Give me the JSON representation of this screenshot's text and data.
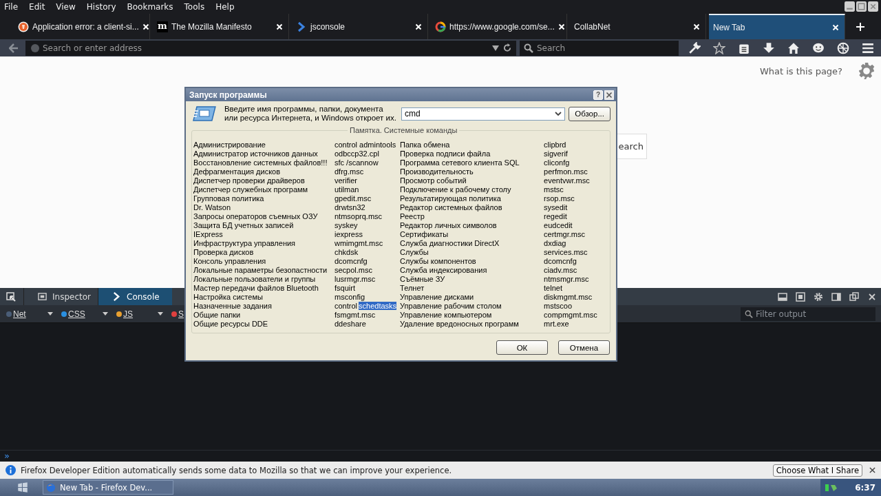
{
  "menu": [
    "File",
    "Edit",
    "View",
    "History",
    "Bookmarks",
    "Tools",
    "Help"
  ],
  "tabs": [
    {
      "title": "Application error: a client-si...",
      "selected": false
    },
    {
      "title": "The Mozilla Manifesto",
      "selected": false,
      "icon_text": "m"
    },
    {
      "title": "jsconsole",
      "selected": false
    },
    {
      "title": "https://www.google.com/se...",
      "selected": false
    },
    {
      "title": "CollabNet",
      "selected": false
    },
    {
      "title": "New Tab",
      "selected": true
    }
  ],
  "address": {
    "placeholder": "Search or enter address"
  },
  "search": {
    "placeholder": "Search"
  },
  "page": {
    "help_link": "What is this page?",
    "search_button": "earch"
  },
  "devtools": {
    "tabs": [
      {
        "label": "Inspector",
        "selected": false
      },
      {
        "label": "Console",
        "selected": true
      }
    ],
    "filters": [
      {
        "label": "Net",
        "color": "#4a5d77"
      },
      {
        "label": "CSS",
        "color": "#2a8fe0"
      },
      {
        "label": "JS",
        "color": "#e8a030"
      },
      {
        "label": "S",
        "color": "#e0403f"
      }
    ],
    "filter_placeholder": "Filter output",
    "prompt": "»"
  },
  "notification": {
    "text": "Firefox Developer Edition automatically sends some data to Mozilla so that we can improve your experience.",
    "button": "Choose What I Share"
  },
  "taskbar": {
    "task": "New Tab - Firefox Dev...",
    "clock": "6:37"
  },
  "dialog": {
    "title": "Запуск программы",
    "help": "?",
    "intro": "Введите имя программы, папки, документа или ресурса Интернета, и Windows откроет их.",
    "value": "cmd",
    "browse": "Обзор...",
    "group_title": "Памятка. Системные команды",
    "left": [
      {
        "name": "Администрирование",
        "command": "control admintools"
      },
      {
        "name": "Администратор источников данных",
        "command": "odbccp32.cpl"
      },
      {
        "name": "Восстановление системных файлов!!!",
        "command": "sfc /scannow"
      },
      {
        "name": "Дефрагментация дисков",
        "command": "dfrg.msc"
      },
      {
        "name": "Диспетчер проверки драйверов",
        "command": "verifier"
      },
      {
        "name": "Диспетчер служебных программ",
        "command": "utilman"
      },
      {
        "name": "Групповая политика",
        "command": "gpedit.msc"
      },
      {
        "name": "Dr. Watson",
        "command": "drwtsn32"
      },
      {
        "name": "Запросы операторов съемных ОЗУ",
        "command": "ntmsoprq.msc"
      },
      {
        "name": "Защита БД учетных записей",
        "command": "syskey"
      },
      {
        "name": "IExpress",
        "command": "iexpress"
      },
      {
        "name": "Инфраструктура управления",
        "command": "wmimgmt.msc"
      },
      {
        "name": "Проверка дисков",
        "command": "chkdsk"
      },
      {
        "name": "Консоль управления",
        "command": "dcomcnfg"
      },
      {
        "name": "Локальные параметры безопастности",
        "command": "secpol.msc"
      },
      {
        "name": "Локальные пользователи и группы",
        "command": "lusrmgr.msc"
      },
      {
        "name": "Мастер передачи файлов Bluetooth",
        "command": "fsquirt"
      },
      {
        "name": "Настройка системы",
        "command": "msconfig"
      },
      {
        "name": "Назначенные задания",
        "command": "control",
        "selection": "schedtasks"
      },
      {
        "name": "Общие папки",
        "command": "fsmgmt.msc"
      },
      {
        "name": "Общие ресурсы DDE",
        "command": "ddeshare"
      }
    ],
    "right": [
      {
        "name": "Папка обмена",
        "command": "clipbrd"
      },
      {
        "name": "Проверка подписи файла",
        "command": "sigverif"
      },
      {
        "name": "Программа сетевого клиента SQL",
        "command": "cliconfg"
      },
      {
        "name": "Производительность",
        "command": "perfmon.msc"
      },
      {
        "name": "Просмотр событий",
        "command": "eventvwr.msc"
      },
      {
        "name": "Подключение к рабочему столу",
        "command": "mstsc"
      },
      {
        "name": "Результатирующая политика",
        "command": "rsop.msc"
      },
      {
        "name": "Редактор системных файлов",
        "command": "sysedit"
      },
      {
        "name": "Реестр",
        "command": "regedit"
      },
      {
        "name": "Редактор личных символов",
        "command": "eudcedit"
      },
      {
        "name": "Сертификаты",
        "command": "certmgr.msc"
      },
      {
        "name": "Служба диагностики DirectX",
        "command": "dxdiag"
      },
      {
        "name": "Службы",
        "command": "services.msc"
      },
      {
        "name": "Службы компонентов",
        "command": "dcomcnfg"
      },
      {
        "name": "Служба индексирования",
        "command": "ciadv.msc"
      },
      {
        "name": "Съёмные ЗУ",
        "command": "ntmsmgr.msc"
      },
      {
        "name": "Телнет",
        "command": "telnet"
      },
      {
        "name": "Управление дисками",
        "command": "diskmgmt.msc"
      },
      {
        "name": "Управление рабочим столом",
        "command": "mstscoo"
      },
      {
        "name": "Управление компьютером",
        "command": "compmgmt.msc"
      },
      {
        "name": "Удаление вредоносных программ",
        "command": "mrt.exe"
      }
    ],
    "ok": "ОК",
    "cancel": "Отмена"
  }
}
